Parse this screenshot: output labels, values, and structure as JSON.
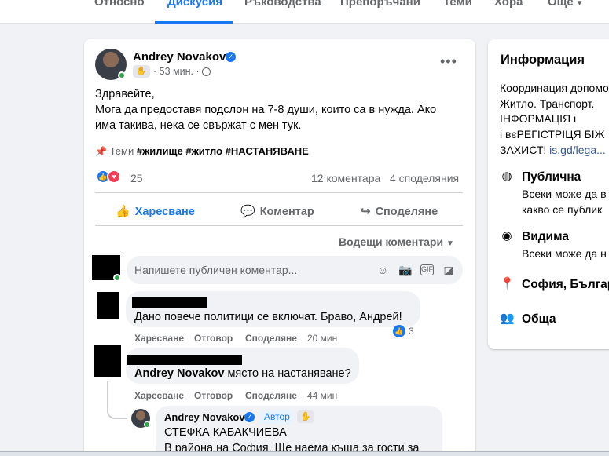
{
  "tabs": [
    {
      "label": "Относно"
    },
    {
      "label": "Дискусия"
    },
    {
      "label": "Ръководства"
    },
    {
      "label": "Препоръчани"
    },
    {
      "label": "Теми"
    },
    {
      "label": "Хора"
    },
    {
      "label": "Още"
    }
  ],
  "post": {
    "author": "Andrey Novakov",
    "time": "53 мин.",
    "text": [
      "Здравейте,",
      "Мога да предоставя подслон на 7-8 души, които са в нужда. Ако",
      "има такива, нека се свържат с мен тук."
    ],
    "topics_label": "Теми",
    "topics": [
      "#жилище",
      "#житло",
      "#НАСТАНЯВАНЕ"
    ],
    "reaction_count": "25",
    "comments_count": "12 коментара",
    "shares_count": "4 споделяния",
    "actions": {
      "like": "Харесване",
      "comment": "Коментар",
      "share": "Споделяне"
    },
    "sort_label": "Водещи коментари"
  },
  "composer": {
    "placeholder": "Напишете публичен коментар..."
  },
  "comments": [
    {
      "text": "Дано повече политици се включат. Браво, Андрей!",
      "like": "Харесване",
      "reply": "Отговор",
      "share": "Споделяне",
      "time": "20 мин",
      "reactions": "3"
    },
    {
      "mention": "Andrey Novakov",
      "text": " място на настаняване?",
      "like": "Харесване",
      "reply": "Отговор",
      "share": "Споделяне",
      "time": "44 мин"
    }
  ],
  "reply": {
    "author": "Andrey Novakov",
    "badge": "Автор",
    "mention": "СТЕФКА КАБАКЧИЕВА",
    "text": "В района на София. Ще наема къща за гости за"
  },
  "info": {
    "title": "Информация",
    "desc_lines": [
      "Координация допомо",
      "Житло. Транспорт.",
      "ІНФОРМАЦІЯ і",
      " і вєРЕГІСТРІЦЯ БІЖ",
      "ЗАХИСТ!"
    ],
    "link": "is.gd/lega...",
    "items": [
      {
        "title": "Публична",
        "sub": [
          "Всеки може да в",
          "какво се публик"
        ]
      },
      {
        "title": "Видима",
        "sub": [
          "Всеки може да н"
        ]
      },
      {
        "title": "София, Българ",
        "sub": []
      },
      {
        "title": "Обща",
        "sub": []
      }
    ]
  },
  "colors": {
    "accent": "#1877f2",
    "background": "#f0f2f5",
    "card": "#ffffff",
    "muted": "#65676b"
  }
}
